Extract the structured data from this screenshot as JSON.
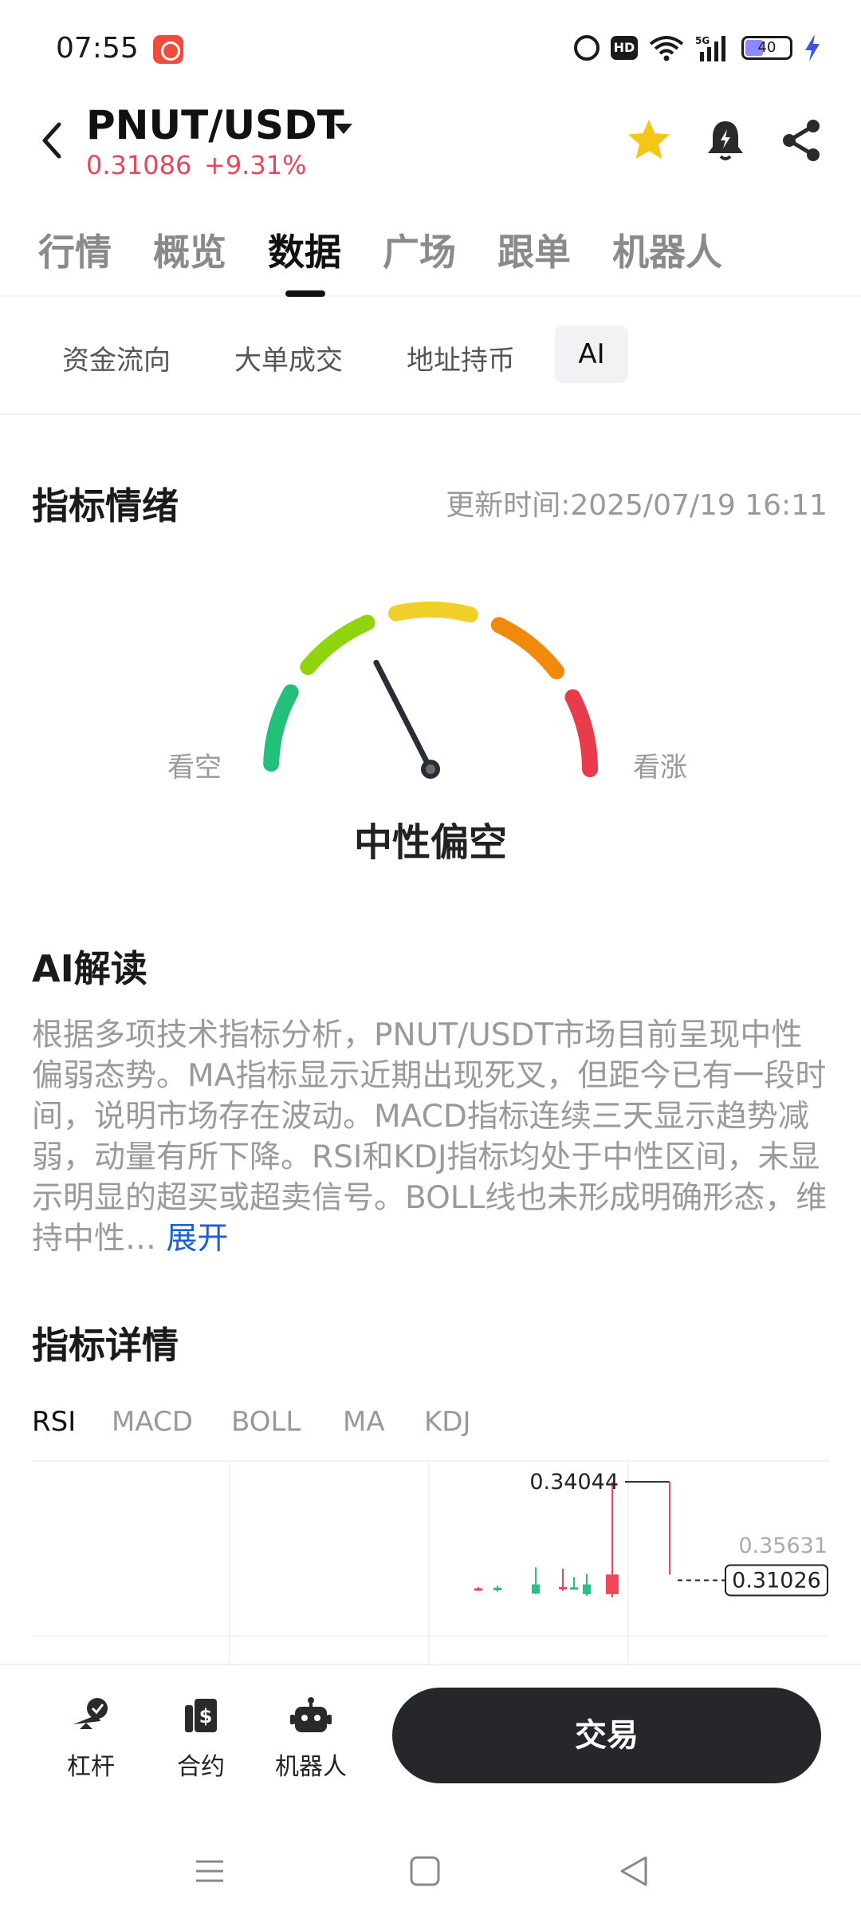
{
  "status_bar": {
    "time": "07:55",
    "hd_label": "HD",
    "network_label": "5G",
    "battery_level": "40",
    "icons": [
      "app-icon",
      "alarm-icon",
      "hd-icon",
      "wifi-icon",
      "signal-icon",
      "battery-icon",
      "charging-icon"
    ]
  },
  "header": {
    "pair": "PNUT/USDT",
    "price": "0.31086",
    "change": "+9.31%",
    "price_color": "#e5485c",
    "favorite_color": "#f5c518",
    "icons": [
      "back-icon",
      "caret-down-icon",
      "star-icon",
      "bell-icon",
      "share-icon"
    ]
  },
  "main_tabs": [
    {
      "label": "行情",
      "active": false
    },
    {
      "label": "概览",
      "active": false
    },
    {
      "label": "数据",
      "active": true
    },
    {
      "label": "广场",
      "active": false
    },
    {
      "label": "跟单",
      "active": false
    },
    {
      "label": "机器人",
      "active": false
    }
  ],
  "sub_tabs": [
    {
      "label": "资金流向",
      "active": false
    },
    {
      "label": "大单成交",
      "active": false
    },
    {
      "label": "地址持币",
      "active": false
    },
    {
      "label": "AI",
      "active": true
    }
  ],
  "sentiment": {
    "title": "指标情绪",
    "update_time": "更新时间:2025/07/19 16:11",
    "bear_label": "看空",
    "bull_label": "看涨",
    "result": "中性偏空",
    "level": 0.35,
    "segment_colors": [
      "#22c07a",
      "#8fd40e",
      "#f0cf2a",
      "#f08a0c",
      "#e83c4c"
    ]
  },
  "ai_analysis": {
    "title": "AI解读",
    "text": "根据多项技术指标分析，PNUT/USDT市场目前呈现中性偏弱态势。MA指标显示近期出现死叉，但距今已有一段时间，说明市场存在波动。MACD指标连续三天显示趋势减弱，动量有所下降。RSI和KDJ指标均处于中性区间，未显示明显的超买或超卖信号。BOLL线也未形成明确形态，维持中性…",
    "expand_label": "展开",
    "link_color": "#1f5fd6"
  },
  "indicator_details": {
    "title": "指标详情",
    "tabs": [
      {
        "label": "RSI",
        "active": true
      },
      {
        "label": "MACD",
        "active": false
      },
      {
        "label": "BOLL",
        "active": false
      },
      {
        "label": "MA",
        "active": false
      },
      {
        "label": "KDJ",
        "active": false
      }
    ]
  },
  "chart_data": {
    "type": "candlestick",
    "y_axis_top_label": "0.35631",
    "high_marker_label": "0.34044",
    "current_price_label": "0.31026",
    "visible_range": [
      0.305,
      0.3563
    ],
    "candles": [
      {
        "open": 0.3074,
        "close": 0.3078,
        "high": 0.3082,
        "low": 0.307,
        "color": "red"
      },
      {
        "open": 0.3072,
        "close": 0.308,
        "high": 0.3086,
        "low": 0.3068,
        "color": "green"
      },
      {
        "open": 0.3062,
        "close": 0.309,
        "high": 0.3142,
        "low": 0.306,
        "color": "green"
      },
      {
        "open": 0.3082,
        "close": 0.3079,
        "high": 0.3138,
        "low": 0.307,
        "color": "red"
      },
      {
        "open": 0.3078,
        "close": 0.3081,
        "high": 0.3112,
        "low": 0.3074,
        "color": "green"
      },
      {
        "open": 0.306,
        "close": 0.309,
        "high": 0.3122,
        "low": 0.3055,
        "color": "green"
      },
      {
        "open": 0.312,
        "close": 0.306,
        "high": 0.3404,
        "low": 0.305,
        "color": "red"
      }
    ],
    "up_color": "#2ebd85",
    "down_color": "#f0465a"
  },
  "bottom_bar": {
    "items": [
      {
        "label": "杠杆",
        "icon": "leverage-icon"
      },
      {
        "label": "合约",
        "icon": "contract-icon"
      },
      {
        "label": "机器人",
        "icon": "robot-icon"
      }
    ],
    "trade_label": "交易",
    "trade_color": "#26272b"
  },
  "system_nav": {
    "icons": [
      "menu-icon",
      "home-icon",
      "back-triangle-icon"
    ]
  }
}
